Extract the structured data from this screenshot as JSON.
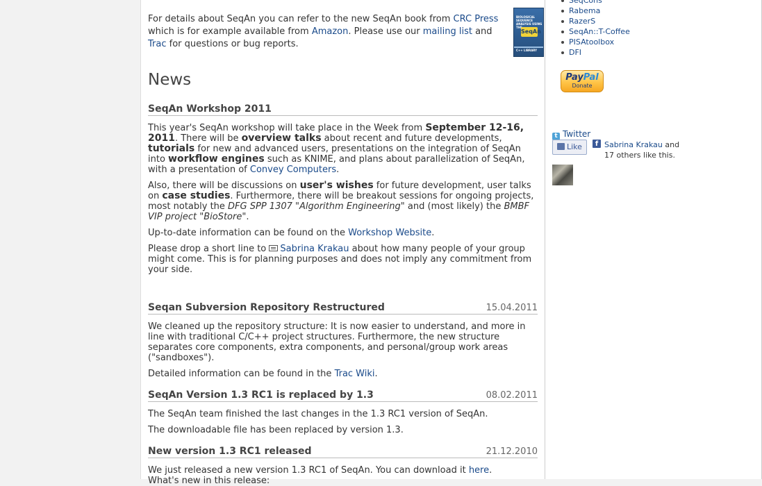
{
  "intro": {
    "t1": "For details about SeqAn you can refer to the new SeqAn book from ",
    "crc_link": "CRC Press",
    "t2": " which is for example available from ",
    "amazon_link": "Amazon",
    "t3": ". Please use our ",
    "mailing_link": "mailing list",
    "t4": " and ",
    "trac_link": "Trac",
    "t5": " for questions or bug reports."
  },
  "book": {
    "title_lines": "BIOLOGICAL SEQUENCE ANALYSIS USING THE",
    "logo": "SeqAn",
    "subtitle": "C++ LIBRARY"
  },
  "news_heading": "News",
  "articles": [
    {
      "title": "SeqAn Workshop 2011",
      "date": "",
      "p1": {
        "a": "This year's SeqAn workshop will take place in the Week from ",
        "b_dates": "September 12-16, 2011",
        "c": ". There will be ",
        "b_overview": "overview talks",
        "d": " about recent and future developments, ",
        "b_tutorials": "tutorials",
        "e": " for new and advanced users, presentations on the integration of SeqAn into ",
        "b_workflow": "workflow engines",
        "f": " such as KNIME, and plans about parallelization of SeqAn, with a presentation of ",
        "link_convey": "Convey Computers",
        "g": "."
      },
      "p2": {
        "a": "Also, there will be discussions on ",
        "b_wishes": "user's wishes",
        "b": " for future development, user talks on ",
        "b_case": "case studies",
        "c": ". Furthermore, there will be breakout sessions for ongoing projects, most notably the ",
        "i_dfg": "DFG SPP 1307 \"Algorithm Engineering\"",
        "d": " and (most likely) the ",
        "i_bmbf": "BMBF VIP project \"BioStore\"",
        "e": "."
      },
      "p3": {
        "a": "Up-to-date information can be found on the ",
        "link_workshop": "Workshop Website",
        "b": "."
      },
      "p4": {
        "a": "Please drop a short line to ",
        "link_sabrina": "Sabrina Krakau",
        "b": " about how many people of your group might come. This is for planning purposes and does not imply any commitment from your side."
      }
    },
    {
      "title": "Seqan Subversion Repository Restructured",
      "date": "15.04.2011",
      "p1": "We cleaned up the repository structure: It is now easier to understand, and more in line with traditional C/C++ project structures. Furthermore, the new structure separates core components, extra components, and personal/group work areas (\"sandboxes\").",
      "p2": {
        "a": "Detailed information can be found in the ",
        "link_wiki": "Trac Wiki",
        "b": "."
      }
    },
    {
      "title": "SeqAn Version 1.3 RC1 is replaced by 1.3",
      "date": "08.02.2011",
      "p1": "The SeqAn team finished the last changes in the 1.3 RC1 version of SeqAn.",
      "p2": "The downloadable file has been replaced by version 1.3."
    },
    {
      "title": "New version 1.3 RC1 released",
      "date": "21.12.2010",
      "p1": {
        "a": "We just released a new version 1.3 RC1 of SeqAn. You can download it ",
        "link_here": "here",
        "b": "."
      },
      "p2": "What's new in this release:"
    }
  ],
  "sidebar": {
    "apps": [
      "SeqCons",
      "Rabema",
      "RazerS",
      "SeqAn::T-Coffee",
      "PISAtoolbox",
      "DFI"
    ],
    "paypal_logo_a": "Pay",
    "paypal_logo_b": "Pal",
    "paypal_donate": "Donate",
    "twitter_icon": "twitter-bird-icon",
    "twitter_label": "Twitter",
    "like_label": "Like",
    "like_name": "Sabrina Krakau",
    "like_rest": " and 17 others like this."
  }
}
